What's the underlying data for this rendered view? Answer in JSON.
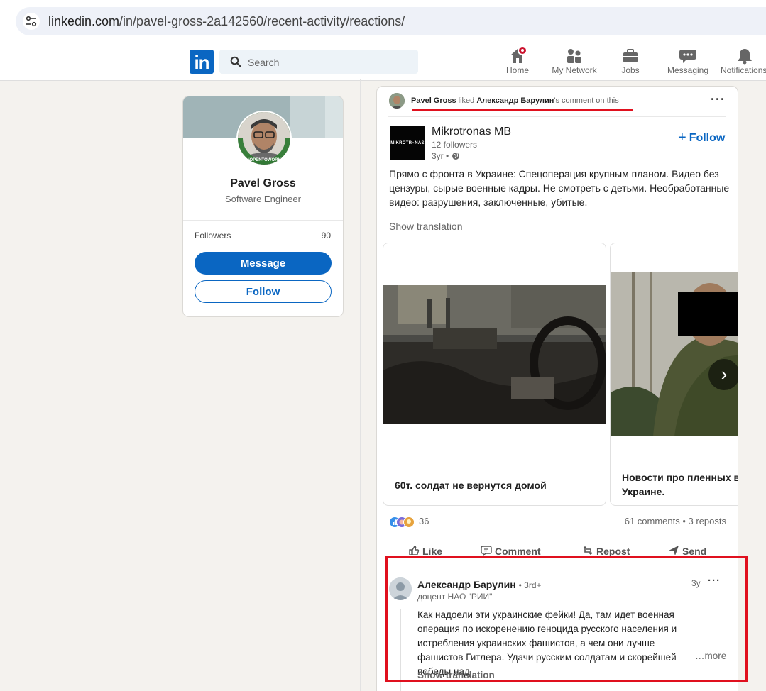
{
  "browser": {
    "url_host": "linkedin.com",
    "url_path": "/in/pavel-gross-2a142560/recent-activity/reactions/"
  },
  "nav": {
    "logo": "in",
    "search_placeholder": "Search",
    "items": [
      {
        "label": "Home",
        "icon": "home-icon",
        "badge": true
      },
      {
        "label": "My Network",
        "icon": "network-icon"
      },
      {
        "label": "Jobs",
        "icon": "briefcase-icon"
      },
      {
        "label": "Messaging",
        "icon": "messaging-icon"
      },
      {
        "label": "Notifications",
        "icon": "bell-icon"
      }
    ]
  },
  "profile": {
    "name": "Pavel Gross",
    "title": "Software Engineer",
    "avatar_badge": "#OPENTOWORK",
    "followers_label": "Followers",
    "followers_count": "90",
    "message_label": "Message",
    "follow_label": "Follow"
  },
  "activity": {
    "actor": "Pavel Gross",
    "verb": "liked",
    "target": "Александр Барулин",
    "suffix": "'s comment on this"
  },
  "post": {
    "company_name": "Mikrotronas MB",
    "company_logo_text": "MIKROTR⌁NAS",
    "followers": "12 followers",
    "time": "3yr •",
    "follow_label": "Follow",
    "text": "Прямо с фронта в Украине: Спецоперация крупным планом. Видео без цензуры, сырые военные кадры. Не смотреть с детьми. Необработанные видео: разрушения, заключенные, убитые.",
    "show_translation": "Show translation",
    "carousel": [
      {
        "caption": "60т. солдат не вернутся домой"
      },
      {
        "caption": "Новости про пленных во Украине."
      }
    ],
    "reaction_count": "36",
    "comments_meta": "61 comments • 3 reposts",
    "actions": [
      "Like",
      "Comment",
      "Repost",
      "Send"
    ]
  },
  "comment": {
    "author": "Александр Барулин",
    "degree": "• 3rd+",
    "headline": "доцент НАО \"РИИ\"",
    "time": "3y",
    "text": "Как надоели эти украинские фейки! Да, там идет военная операция по искоренению геноцида русского населения и истребления украинских фашистов, а чем они лучше фашистов Гитлера. Удачи русским солдатам и скорейшей победы над",
    "more": "…more",
    "show_translation": "Show translation"
  },
  "colors": {
    "brand": "#0a66c2",
    "annotation_red": "#e0101e",
    "page_bg": "#f4f2ee"
  }
}
